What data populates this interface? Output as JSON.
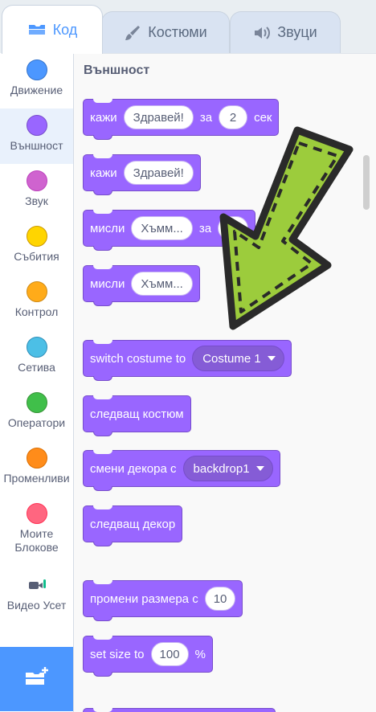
{
  "tabs": [
    {
      "label": "Код",
      "icon": "code-icon",
      "active": true
    },
    {
      "label": "Костюми",
      "icon": "brush-icon",
      "active": false
    },
    {
      "label": "Звуци",
      "icon": "speaker-icon",
      "active": false
    }
  ],
  "categories": [
    {
      "label": "Движение",
      "color": "#4c97ff",
      "border": "#3373cc"
    },
    {
      "label": "Външност",
      "color": "#9966ff",
      "border": "#774dcb",
      "selected": true
    },
    {
      "label": "Звук",
      "color": "#cf63cf",
      "border": "#bd42bd"
    },
    {
      "label": "Събития",
      "color": "#ffd500",
      "border": "#cc9900"
    },
    {
      "label": "Контрол",
      "color": "#ffab19",
      "border": "#cf8b17"
    },
    {
      "label": "Сетива",
      "color": "#4cbfe6",
      "border": "#2e8eb8"
    },
    {
      "label": "Оператори",
      "color": "#40bf4a",
      "border": "#389438"
    },
    {
      "label": "Променливи",
      "color": "#ff8c1a",
      "border": "#db6e00"
    },
    {
      "label": "Моите Блокове",
      "color": "#ff6680",
      "border": "#ff3355"
    },
    {
      "label": "Видео Усет",
      "icon": "video-sensing-icon"
    }
  ],
  "palette": {
    "section_title": "Външност",
    "blocks": {
      "say_for": {
        "t1": "кажи",
        "input": "Здравей!",
        "t2": "за",
        "num": "2",
        "t3": "сек"
      },
      "say": {
        "t1": "кажи",
        "input": "Здравей!"
      },
      "think_for": {
        "t1": "мисли",
        "input": "Хъмм...",
        "t2": "за"
      },
      "think": {
        "t1": "мисли",
        "input": "Хъмм..."
      },
      "switch_costume": {
        "t1": "switch costume to",
        "drop": "Costume 1"
      },
      "next_costume": {
        "t1": "следващ костюм"
      },
      "switch_backdrop": {
        "t1": "смени декора с",
        "drop": "backdrop1"
      },
      "next_backdrop": {
        "t1": "следващ декор"
      },
      "change_size": {
        "t1": "промени размера с",
        "num": "10"
      },
      "set_size": {
        "t1": "set size to",
        "num": "100",
        "t2": "%"
      }
    }
  },
  "colors": {
    "looks": "#9966ff",
    "accent": "#4c97ff",
    "arrow_fill": "#9ccc3c"
  }
}
